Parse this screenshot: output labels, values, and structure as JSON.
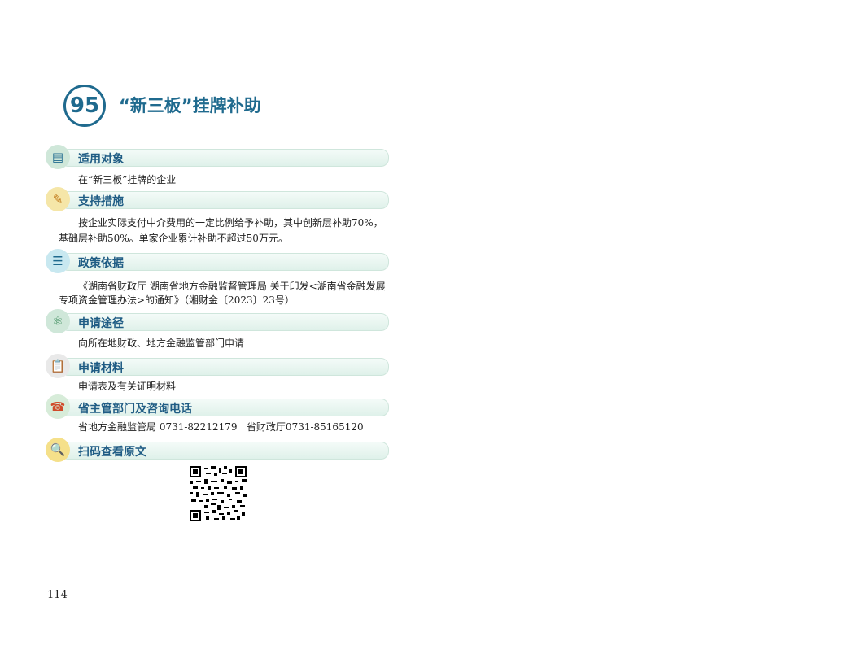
{
  "header": {
    "number": "95",
    "title": "“新三板”挂牌补助"
  },
  "sections": [
    {
      "icon": "document-icon",
      "title": "适用对象",
      "lines": [
        "在“新三板”挂牌的企业"
      ]
    },
    {
      "icon": "certificate-icon",
      "title": "支持措施",
      "lines": [
        "按企业实际支付中介费用的一定比例给予补助，其中创新层补助70%，",
        "基础层补助50%。单家企业累计补助不超过50万元。"
      ]
    },
    {
      "icon": "policy-document-icon",
      "title": "政策依据",
      "lines": [
        "《湖南省财政厅 湖南省地方金融监督管理局 关于印发<湖南省金融发展",
        "专项资金管理办法>的通知》（湘财金〔2023〕23号）"
      ]
    },
    {
      "icon": "atom-icon",
      "title": "申请途径",
      "lines": [
        "向所在地财政、地方金融监管部门申请"
      ]
    },
    {
      "icon": "clipboard-icon",
      "title": "申请材料",
      "lines": [
        "申请表及有关证明材料"
      ]
    },
    {
      "icon": "phone-icon",
      "title": "省主管部门及咨询电话",
      "lines": [
        "省地方金融监管局 0731-82212179   省财政厅0731-85165120"
      ]
    },
    {
      "icon": "magnifier-icon",
      "title": "扫码查看原文",
      "lines": []
    }
  ],
  "colors": {
    "accent": "#1f6a8e",
    "section_title": "#1f5c84",
    "bar": "#dff1ea"
  },
  "page_number": "114"
}
